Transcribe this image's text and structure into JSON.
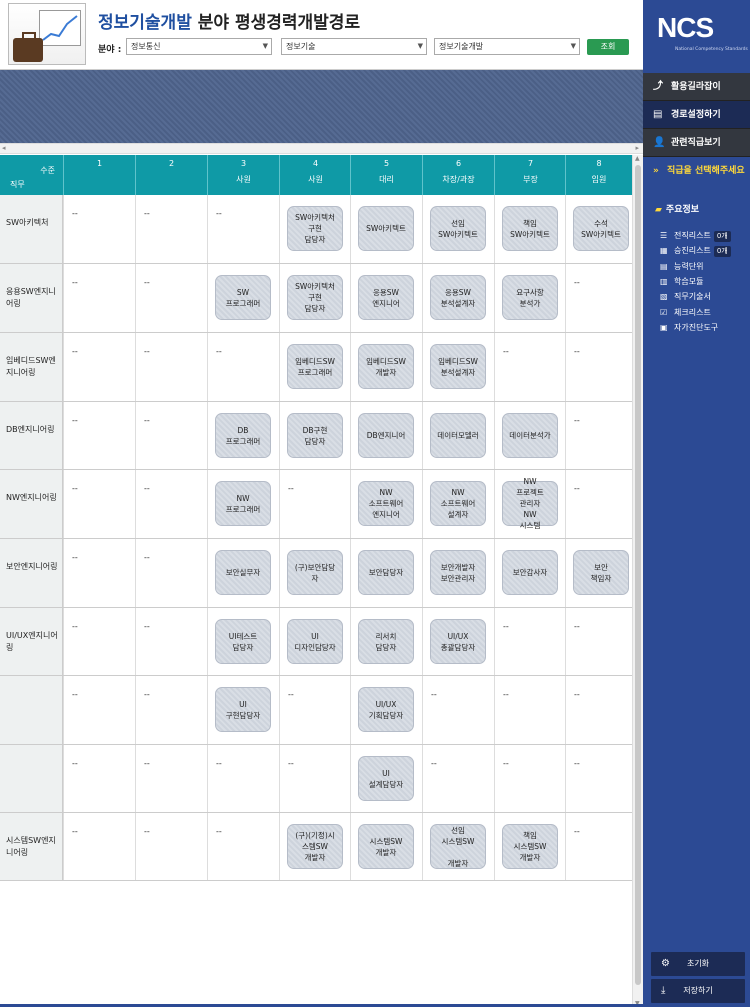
{
  "header": {
    "title_blue": "정보기술개발",
    "title_black": " 분야 평생경력개발경로",
    "field_label": "분야 :",
    "select1": "정보통신",
    "select2": "정보기술",
    "select3": "정보기술개발",
    "search_button": "조회"
  },
  "sidebar": {
    "logo_text": "NCS",
    "logo_sub": "National Competency Standards",
    "btn_guide": "활용길라잡이",
    "btn_path": "경로설정하기",
    "btn_related": "관련직급보기",
    "select_msg": "직급을 선택해주세요",
    "main_info": "주요정보",
    "items": [
      {
        "label": "전직리스트",
        "badge": "0개"
      },
      {
        "label": "승진리스트",
        "badge": "0개"
      },
      {
        "label": "능력단위",
        "badge": ""
      },
      {
        "label": "학습모듈",
        "badge": ""
      },
      {
        "label": "직무기술서",
        "badge": ""
      },
      {
        "label": "체크리스트",
        "badge": ""
      },
      {
        "label": "자가진단도구",
        "badge": ""
      }
    ],
    "btn_reset": "초기화",
    "btn_save": "저장하기"
  },
  "table": {
    "corner_level": "수준",
    "corner_job": "직무",
    "levels": [
      {
        "num": "1",
        "sub": ""
      },
      {
        "num": "2",
        "sub": ""
      },
      {
        "num": "3",
        "sub": "사원"
      },
      {
        "num": "4",
        "sub": "사원"
      },
      {
        "num": "5",
        "sub": "대리"
      },
      {
        "num": "6",
        "sub": "차장/과장"
      },
      {
        "num": "7",
        "sub": "부장"
      },
      {
        "num": "8",
        "sub": "임원"
      }
    ],
    "rows": [
      {
        "label": "SW아키텍처",
        "cells": [
          "--",
          "--",
          "--",
          "SW아키텍처\n구현\n담당자",
          "SW아키텍트",
          "선임\nSW아키텍트",
          "책임\nSW아키텍트",
          "수석\nSW아키텍트"
        ]
      },
      {
        "label": "응용SW엔지니어링",
        "cells": [
          "--",
          "--",
          "SW\n프로그래머",
          "SW아키텍처\n구현\n담당자",
          "응용SW\n엔지니어",
          "응용SW\n분석설계자",
          "요구사항\n분석가",
          "--"
        ]
      },
      {
        "label": "임베디드SW엔지니어링",
        "cells": [
          "--",
          "--",
          "--",
          "임베디드SW\n프로그래머",
          "임베디드SW\n개발자",
          "임베디드SW\n분석설계자",
          "--",
          "--"
        ]
      },
      {
        "label": "DB엔지니어링",
        "cells": [
          "--",
          "--",
          "DB\n프로그래머",
          "DB구현\n담당자",
          "DB엔지니어",
          "데이터모델러",
          "데이터분석가",
          "--"
        ]
      },
      {
        "label": "NW엔지니어링",
        "cells": [
          "--",
          "--",
          "NW\n프로그래머",
          "--",
          "NW\n소프트웨어\n엔지니어",
          "NW\n소프트웨어\n설계자",
          "NW\n프로젝트\n관리자\nNW\n시스템",
          "--"
        ]
      },
      {
        "label": "보안엔지니어링",
        "cells": [
          "--",
          "--",
          "보안실무자",
          "(구)보안담당\n자",
          "보안담당자",
          "보안개발자\n보안관리자",
          "보안감사자",
          "보안\n책임자"
        ]
      },
      {
        "label": "UI/UX엔지니어링",
        "cells": [
          "--",
          "--",
          "UI테스트\n담당자",
          "UI\n디자인담당자",
          "리서치\n담당자",
          "UI/UX\n총괄담당자",
          "--",
          "--"
        ]
      },
      {
        "label": "",
        "cells": [
          "--",
          "--",
          "UI\n구현담당자",
          "--",
          "UI/UX\n기획담당자",
          "--",
          "--",
          "--"
        ]
      },
      {
        "label": "",
        "cells": [
          "--",
          "--",
          "--",
          "--",
          "UI\n설계담당자",
          "--",
          "--",
          "--"
        ]
      },
      {
        "label": "시스템SW엔지니어링",
        "cells": [
          "--",
          "--",
          "--",
          "(구)(기정)시\n스템SW\n개발자",
          "시스템SW\n개발자",
          "선임\n시스템SW\n\n개발자",
          "책임\n시스템SW\n개발자",
          "--"
        ]
      }
    ]
  }
}
